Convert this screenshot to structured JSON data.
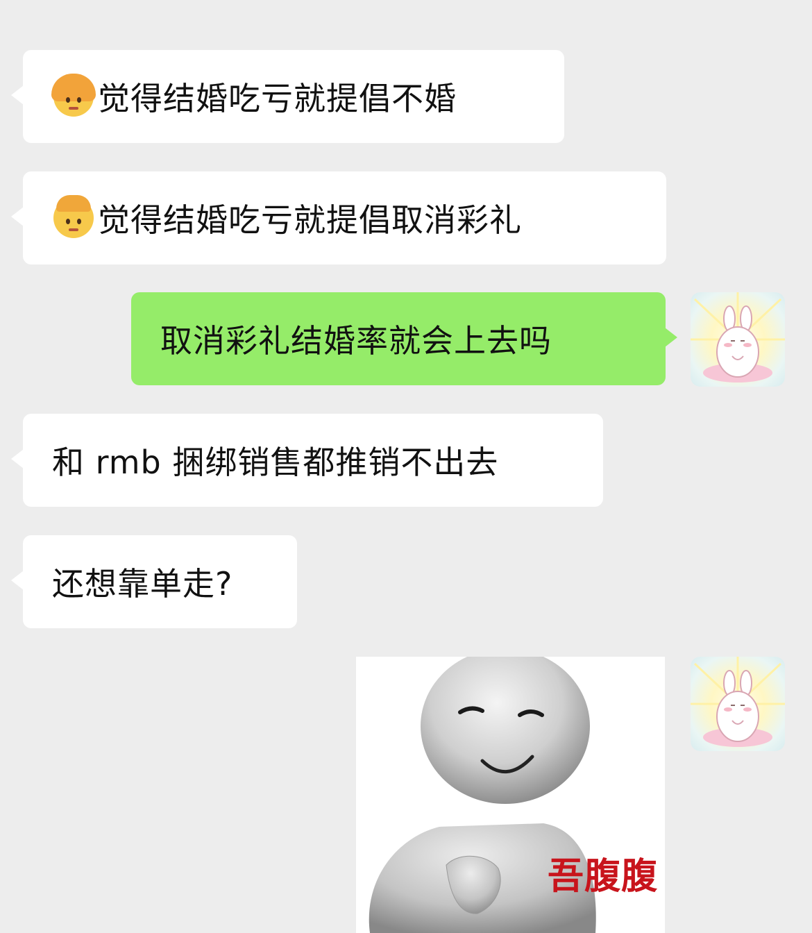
{
  "messages": [
    {
      "side": "incoming",
      "emoji": "woman-emoji",
      "text": "觉得结婚吃亏就提倡不婚"
    },
    {
      "side": "incoming",
      "emoji": "man-emoji",
      "text": "觉得结婚吃亏就提倡取消彩礼"
    },
    {
      "side": "outgoing",
      "text": "取消彩礼结婚率就会上去吗"
    },
    {
      "side": "incoming",
      "text": "和 rmb 捆绑销售都推销不出去"
    },
    {
      "side": "incoming",
      "text": "还想靠单走?"
    },
    {
      "side": "outgoing",
      "type": "sticker",
      "caption": "吾腹腹"
    }
  ],
  "colors": {
    "background": "#ededed",
    "incoming_bubble": "#ffffff",
    "outgoing_bubble": "#95ec69",
    "sticker_caption": "#c8141c"
  }
}
